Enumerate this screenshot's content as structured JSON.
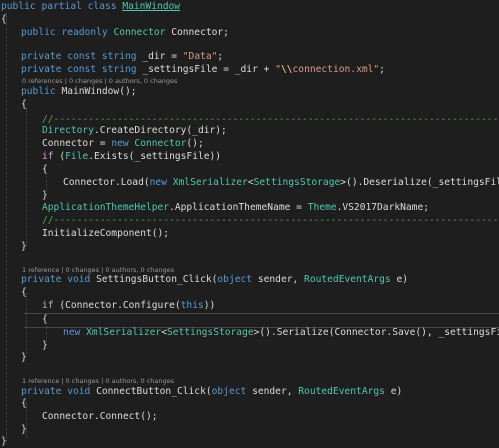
{
  "code": {
    "class_decl": [
      "public",
      "partial",
      "class",
      "MainWindow"
    ],
    "open_brace": "{",
    "close_brace": "}",
    "field_connector": [
      "public",
      "readonly",
      "Connector",
      "Connector;"
    ],
    "const_dir": [
      "private",
      "const",
      "string",
      "_dir = ",
      "\"Data\"",
      ";"
    ],
    "const_settings": [
      "private",
      "const",
      "string",
      "_settingsFile = _dir + ",
      "\"",
      "\\\\",
      "connection.xml\"",
      ";"
    ],
    "ctor_lens": "0 references | 0 changes | 0 authors, 0 changes",
    "ctor_decl": [
      "public",
      "MainWindow();"
    ],
    "ctor_comment": "//---------------------------------------------------------------------------------",
    "create_dir": [
      "Directory",
      ".CreateDirectory(_dir);"
    ],
    "new_connector": [
      "Connector = ",
      "new",
      "Connector",
      "();"
    ],
    "if_exists": [
      "if",
      " (",
      "File",
      ".Exists(_settingsFile))"
    ],
    "load_line": [
      "Connector.Load(",
      "new",
      "XmlSerializer",
      "<",
      "SettingsStorage",
      ">().Deserialize(_settingsFile));"
    ],
    "theme_line": [
      "ApplicationThemeHelper",
      ".ApplicationThemeName = ",
      "Theme",
      ".VS2017DarkName;"
    ],
    "init_component": "InitializeComponent();",
    "settings_lens": "1 reference | 0 changes | 0 authors, 0 changes",
    "settings_decl": [
      "private",
      "void",
      "SettingsButton_Click(",
      "object",
      " sender, ",
      "RoutedEventArgs",
      " e)"
    ],
    "if_configure": [
      "if",
      " (Connector.Configure(",
      "this",
      "))"
    ],
    "serialize_line": [
      "new",
      "XmlSerializer",
      "<",
      "SettingsStorage",
      ">().Serialize(Connector.Save(), _settingsFile);"
    ],
    "connect_lens": "1 reference | 0 changes | 0 authors, 0 changes",
    "connect_decl": [
      "private",
      "void",
      "ConnectButton_Click(",
      "object",
      " sender, ",
      "RoutedEventArgs",
      " e)"
    ],
    "connect_call": "Connector.Connect();"
  },
  "colors": {
    "background": "#1e1e1e",
    "keyword": "#569cd6",
    "type": "#4ec9b0",
    "string": "#d69d85",
    "comment": "#57a64a",
    "text": "#dcdcdc",
    "code_lens": "#999999"
  }
}
